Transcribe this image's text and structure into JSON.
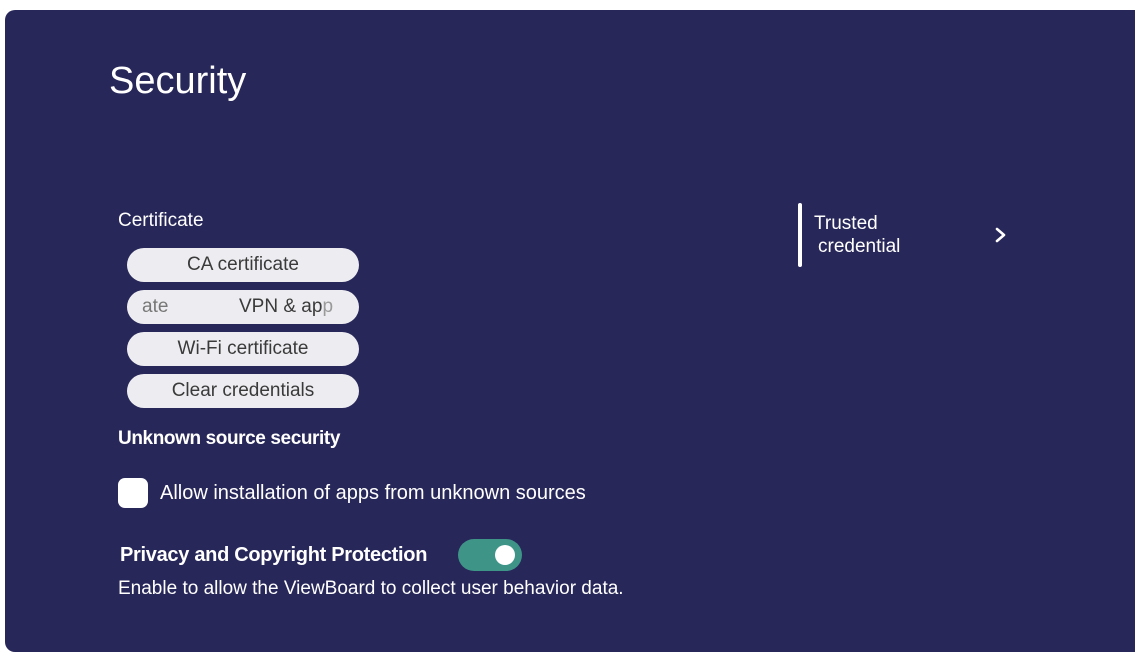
{
  "page": {
    "title": "Security"
  },
  "certificate": {
    "label": "Certificate",
    "buttons": [
      {
        "label": "CA certificate"
      },
      {
        "label_fragment": "ate",
        "label_main": "VPN & ap",
        "label_fade": "p"
      },
      {
        "label": "Wi-Fi certificate"
      },
      {
        "label": "Clear credentials"
      }
    ]
  },
  "unknown_source": {
    "title": "Unknown source security",
    "checkbox_label": "Allow installation of apps from unknown sources",
    "checked": false
  },
  "privacy": {
    "title": "Privacy and Copyright Protection",
    "enabled": true,
    "description": "Enable to allow the ViewBoard to collect user behavior data."
  },
  "trusted_credential": {
    "line1": "Trusted",
    "line2": "credential",
    "icon": "chevron-right-icon"
  },
  "colors": {
    "background": "#27275a",
    "pill": "#ededf1",
    "toggle_on": "#3f9488"
  }
}
